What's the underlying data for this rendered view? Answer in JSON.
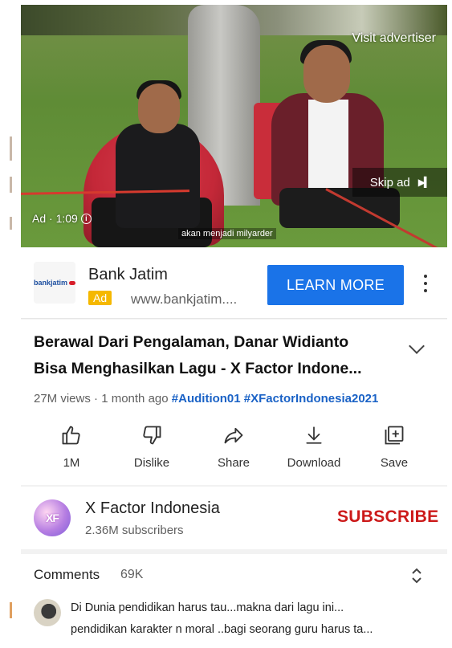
{
  "video": {
    "visit_advertiser": "Visit advertiser",
    "skip_ad": "Skip ad",
    "ad_time": "Ad · 1:09",
    "caption": "akan menjadi milyarder"
  },
  "ad": {
    "logo_text": "bankjatim",
    "name": "Bank Jatim",
    "badge": "Ad",
    "url": "www.bankjatim....",
    "cta": "LEARN MORE"
  },
  "video_info": {
    "title_line1": "Berawal Dari Pengalaman, Danar Widianto",
    "title_line2": "Bisa Menghasilkan Lagu - X Factor Indone...",
    "views": "27M views",
    "age": "1 month ago",
    "hashtags": [
      "#Audition01",
      "#XFactorIndonesia2021"
    ]
  },
  "actions": [
    {
      "label": "1M",
      "icon": "thumbs-up-icon"
    },
    {
      "label": "Dislike",
      "icon": "thumbs-down-icon"
    },
    {
      "label": "Share",
      "icon": "share-icon"
    },
    {
      "label": "Download",
      "icon": "download-icon"
    },
    {
      "label": "Save",
      "icon": "add-to-playlist-icon"
    }
  ],
  "channel": {
    "avatar_text": "XF",
    "name": "X Factor Indonesia",
    "subscribers": "2.36M subscribers",
    "subscribe_label": "SUBSCRIBE"
  },
  "comments": {
    "heading": "Comments",
    "count": "69K",
    "top_comment_line1": "Di Dunia pendidikan harus tau...makna dari lagu ini...",
    "top_comment_line2": "pendidikan karakter n moral ..bagi seorang guru harus ta..."
  },
  "colors": {
    "accent_blue": "#1a73e8",
    "subscribe_red": "#cc1a1a",
    "ad_badge_yellow": "#f5b800",
    "hashtag_blue": "#1a62c6"
  }
}
